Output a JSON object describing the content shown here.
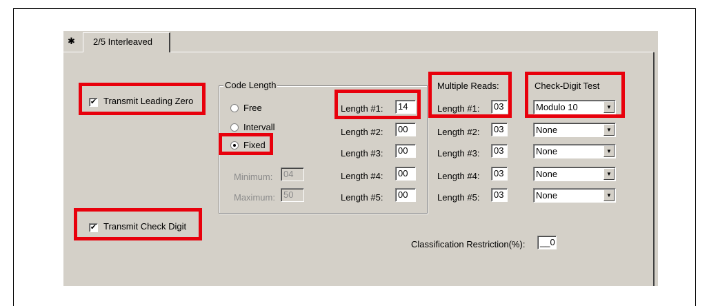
{
  "tab": {
    "label": "2/5 Interleaved"
  },
  "options": {
    "transmit_leading_zero": {
      "label": "Transmit Leading Zero",
      "checked": true
    },
    "transmit_check_digit": {
      "label": "Transmit Check Digit",
      "checked": true
    }
  },
  "code_length": {
    "title": "Code Length",
    "radio_free": "Free",
    "radio_intervall": "Intervall",
    "radio_fixed": "Fixed",
    "selected": "Fixed",
    "minimum_label": "Minimum:",
    "minimum_value": "04",
    "maximum_label": "Maximum:",
    "maximum_value": "50",
    "lengths": [
      {
        "label": "Length #1:",
        "value": "14"
      },
      {
        "label": "Length #2:",
        "value": "00"
      },
      {
        "label": "Length #3:",
        "value": "00"
      },
      {
        "label": "Length #4:",
        "value": "00"
      },
      {
        "label": "Length #5:",
        "value": "00"
      }
    ]
  },
  "multiple_reads": {
    "title": "Multiple Reads:",
    "lengths": [
      {
        "label": "Length #1:",
        "value": "03"
      },
      {
        "label": "Length #2:",
        "value": "03"
      },
      {
        "label": "Length #3:",
        "value": "03"
      },
      {
        "label": "Length #4:",
        "value": "03"
      },
      {
        "label": "Length #5:",
        "value": "03"
      }
    ]
  },
  "check_digit_test": {
    "title": "Check-Digit Test",
    "values": [
      "Modulo 10",
      "None",
      "None",
      "None",
      "None"
    ]
  },
  "classification": {
    "label": "Classification Restriction(%):",
    "value": "__0"
  },
  "colors": {
    "highlight": "#e8000c",
    "dialog_bg": "#d4d0c8"
  }
}
